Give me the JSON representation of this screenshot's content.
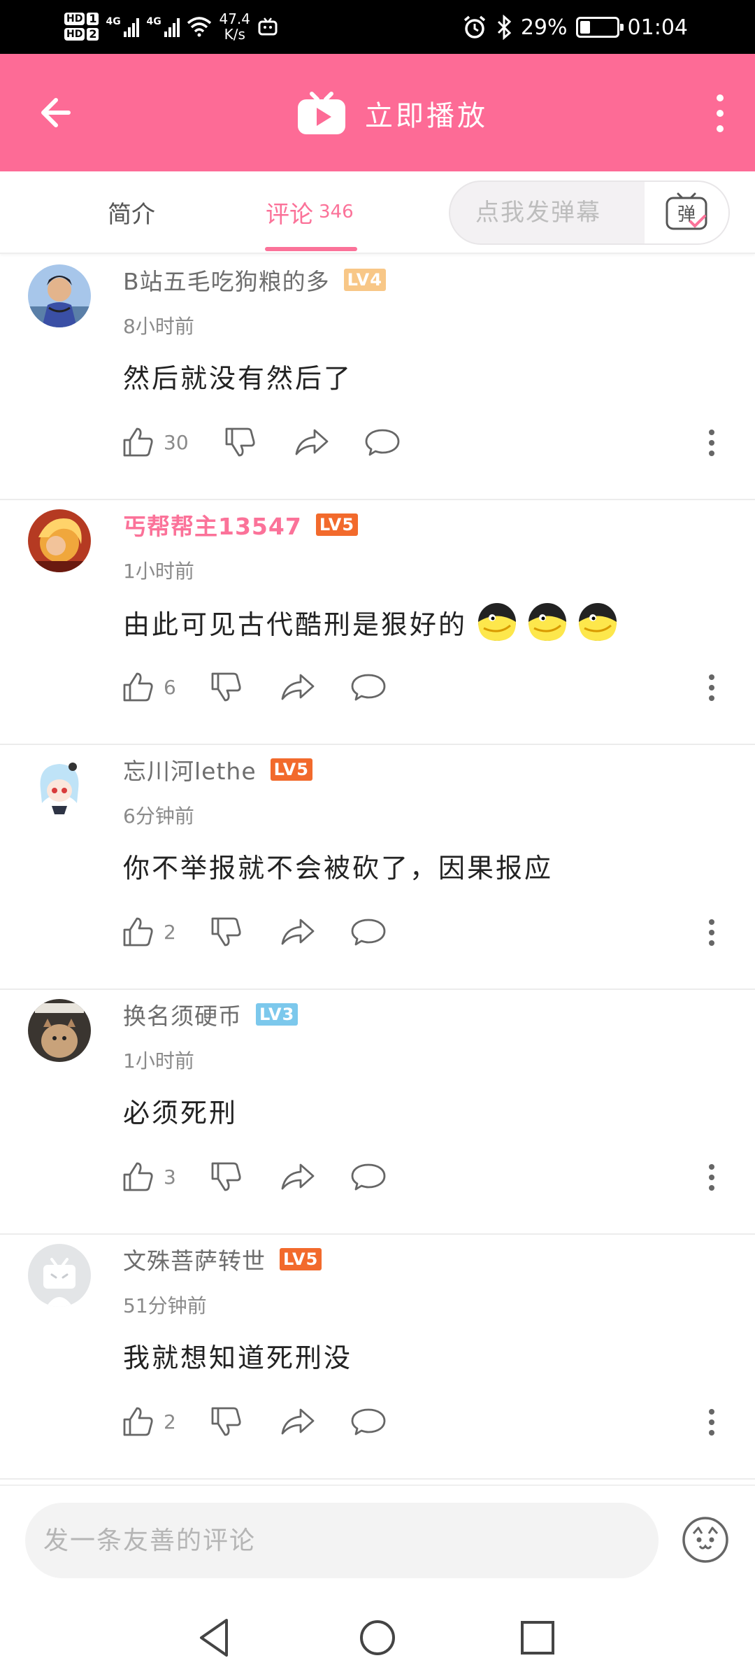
{
  "status_bar": {
    "hd1": "HD",
    "hd1_num": "1",
    "hd2": "HD",
    "hd2_num": "2",
    "net1": "4G",
    "net2": "4G",
    "speed_value": "47.4",
    "speed_unit": "K/s",
    "battery_percent": "29%",
    "battery_level": 0.29,
    "time": "01:04"
  },
  "header": {
    "title": "立即播放",
    "accent_color": "#fd6b96"
  },
  "tabs": {
    "intro_label": "简介",
    "comments_label": "评论",
    "comments_count": "346",
    "danmu_placeholder": "点我发弹幕",
    "danmu_icon_label": "弹"
  },
  "comments": [
    {
      "username": "B站五毛吃狗粮的多",
      "level": "LV4",
      "level_color": "#f8c787",
      "time": "8小时前",
      "content": "然后就没有然后了",
      "likes": "30",
      "vip": false
    },
    {
      "username": "丐帮帮主13547",
      "level": "LV5",
      "level_color": "#f26a2c",
      "time": "1小时前",
      "content": "由此可见古代酷刑是狠好的",
      "likes": "6",
      "vip": true
    },
    {
      "username": "忘川河lethe",
      "level": "LV5",
      "level_color": "#f26a2c",
      "time": "6分钟前",
      "content": "你不举报就不会被砍了，因果报应",
      "likes": "2",
      "vip": false
    },
    {
      "username": "换名须硬币",
      "level": "LV3",
      "level_color": "#7cc8ec",
      "time": "1小时前",
      "content": "必须死刑",
      "likes": "3",
      "vip": false
    },
    {
      "username": "文殊菩萨转世",
      "level": "LV5",
      "level_color": "#f26a2c",
      "time": "51分钟前",
      "content": "我就想知道死刑没",
      "likes": "2",
      "vip": false
    }
  ],
  "input": {
    "placeholder": "发一条友善的评论"
  },
  "icons": {
    "back": "arrow-left-icon",
    "play": "tv-play-icon",
    "more": "more-vertical-icon",
    "like": "thumb-up-icon",
    "dislike": "thumb-down-icon",
    "share": "share-icon",
    "reply": "reply-bubble-icon",
    "emoji": "emoji-icon",
    "nav_back": "nav-back-icon",
    "nav_home": "nav-home-icon",
    "nav_recent": "nav-recent-icon"
  }
}
